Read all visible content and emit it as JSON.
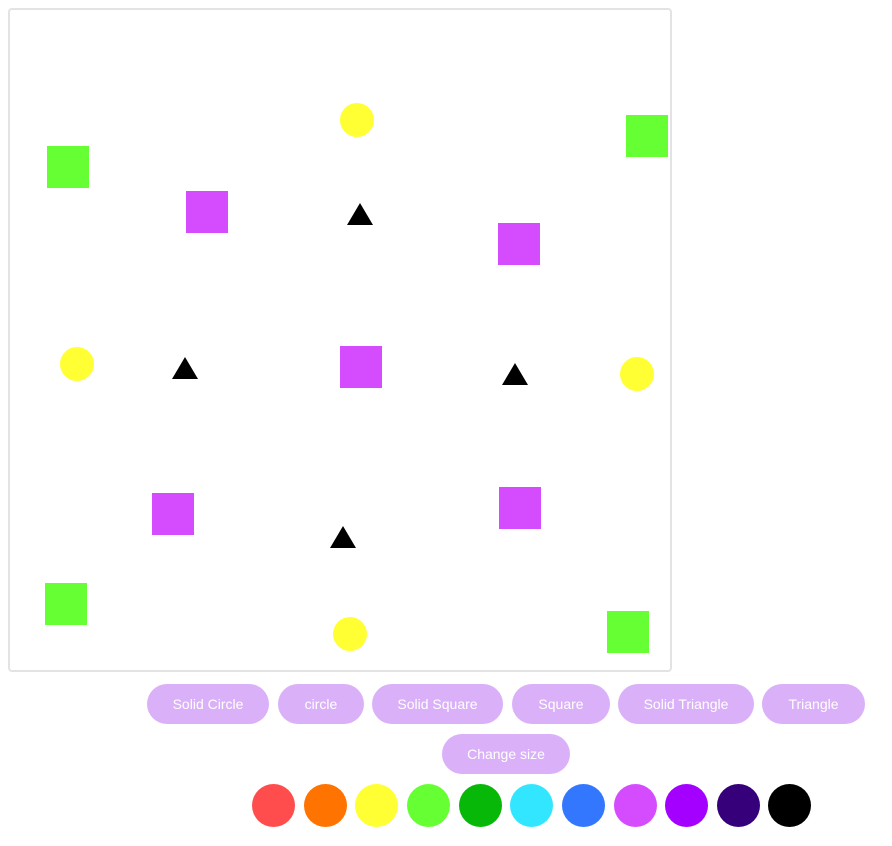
{
  "colors": {
    "canvas_border": "#e3e3e3",
    "button_bg": "#dab0f8",
    "button_text": "#ffffff",
    "shape_green": "#66ff33",
    "shape_magenta": "#d54cff",
    "shape_yellow": "#ffff33",
    "shape_black": "#000000"
  },
  "canvas": {
    "shapes": [
      {
        "type": "square",
        "color": "green"
      },
      {
        "type": "square",
        "color": "green"
      },
      {
        "type": "square",
        "color": "green"
      },
      {
        "type": "square",
        "color": "green"
      },
      {
        "type": "square",
        "color": "magenta"
      },
      {
        "type": "square",
        "color": "magenta"
      },
      {
        "type": "square",
        "color": "magenta"
      },
      {
        "type": "square",
        "color": "magenta"
      },
      {
        "type": "square",
        "color": "magenta"
      },
      {
        "type": "circle",
        "color": "yellow"
      },
      {
        "type": "circle",
        "color": "yellow"
      },
      {
        "type": "circle",
        "color": "yellow"
      },
      {
        "type": "circle",
        "color": "yellow"
      },
      {
        "type": "triangle",
        "color": "black"
      },
      {
        "type": "triangle",
        "color": "black"
      },
      {
        "type": "triangle",
        "color": "black"
      },
      {
        "type": "triangle",
        "color": "black"
      }
    ]
  },
  "buttons": {
    "solid_circle": "Solid Circle",
    "circle": "circle",
    "solid_square": "Solid Square",
    "square": "Square",
    "solid_triangle": "Solid Triangle",
    "triangle": "Triangle",
    "change_size": "Change size"
  },
  "palette": [
    {
      "name": "red",
      "hex": "#ff4d4d"
    },
    {
      "name": "orange",
      "hex": "#ff7300"
    },
    {
      "name": "yellow",
      "hex": "#ffff33"
    },
    {
      "name": "light-green",
      "hex": "#66ff33"
    },
    {
      "name": "green",
      "hex": "#08b808"
    },
    {
      "name": "cyan",
      "hex": "#33e6ff"
    },
    {
      "name": "blue",
      "hex": "#3377ff"
    },
    {
      "name": "magenta",
      "hex": "#d54cff"
    },
    {
      "name": "purple",
      "hex": "#a300ff"
    },
    {
      "name": "indigo",
      "hex": "#36007a"
    },
    {
      "name": "black",
      "hex": "#000000"
    }
  ]
}
